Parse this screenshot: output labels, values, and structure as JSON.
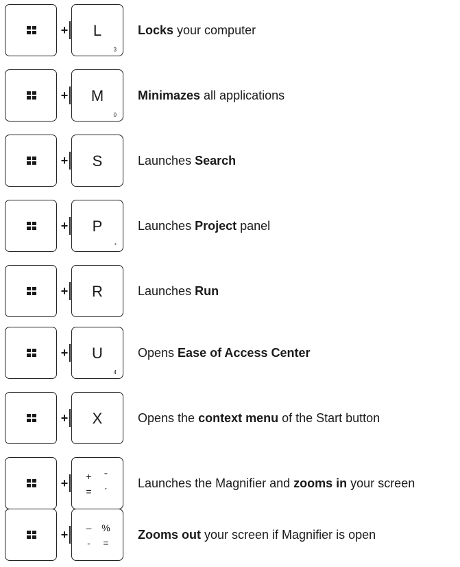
{
  "shortcuts": [
    {
      "key": "L",
      "sub": "3",
      "desc": [
        {
          "t": "Locks",
          "b": true
        },
        {
          "t": " your computer",
          "b": false
        }
      ]
    },
    {
      "key": "M",
      "sub": "0",
      "desc": [
        {
          "t": "Minimazes",
          "b": true
        },
        {
          "t": " all applications",
          "b": false
        }
      ]
    },
    {
      "key": "S",
      "sub": "",
      "desc": [
        {
          "t": "Launches ",
          "b": false
        },
        {
          "t": "Search",
          "b": true
        }
      ]
    },
    {
      "key": "P",
      "sub": "*",
      "desc": [
        {
          "t": "Launches ",
          "b": false
        },
        {
          "t": "Project",
          "b": true
        },
        {
          "t": " panel",
          "b": false
        }
      ]
    },
    {
      "key": "R",
      "sub": "",
      "desc": [
        {
          "t": "Launches ",
          "b": false
        },
        {
          "t": "Run",
          "b": true
        }
      ]
    },
    {
      "key": "U",
      "sub": "4",
      "desc": [
        {
          "t": "Opens ",
          "b": false
        },
        {
          "t": "Ease of Access Center",
          "b": true
        }
      ]
    },
    {
      "key": "X",
      "sub": "",
      "desc": [
        {
          "t": "Opens the ",
          "b": false
        },
        {
          "t": "context menu",
          "b": true
        },
        {
          "t": " of the Start button",
          "b": false
        }
      ]
    },
    {
      "key4": [
        "+",
        "ˇ",
        "=",
        "´"
      ],
      "desc": [
        {
          "t": "Launches the Magnifier and ",
          "b": false
        },
        {
          "t": "zooms in",
          "b": true
        },
        {
          "t": " your screen",
          "b": false
        }
      ]
    },
    {
      "key4": [
        "–",
        "%",
        "-",
        "="
      ],
      "desc": [
        {
          "t": "Zooms out",
          "b": true
        },
        {
          "t": " your screen if Magnifier is open",
          "b": false
        }
      ]
    }
  ],
  "plus_sign": "+",
  "icons": {
    "windows_key": "windows-logo-icon"
  }
}
